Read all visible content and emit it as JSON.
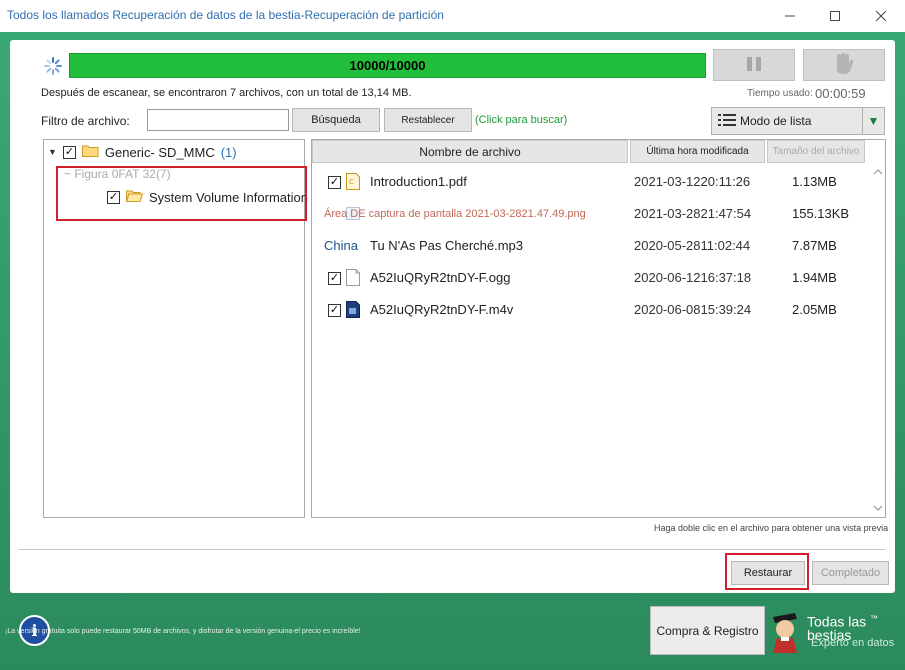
{
  "window": {
    "title": "Todos los llamados Recuperación de datos de la bestia-Recuperación de partición",
    "minimize_icon": "minimize-icon",
    "maximize_icon": "maximize-icon",
    "close_icon": "close-icon"
  },
  "scan": {
    "progress_text": "10000/10000",
    "progress_fraction": 1.0,
    "summary": "Después de escanear, se encontraron 7 archivos, con un total de 13,14 MB.",
    "time_label": "Tiempo usado:",
    "time_value": "00:00:59"
  },
  "filter": {
    "label": "Filtro de archivo:",
    "input_value": "",
    "search_label": "Búsqueda",
    "reset_label": "Restablecer",
    "hint": "(Click para buscar)"
  },
  "view": {
    "mode_label": "Modo de lista"
  },
  "tree": {
    "root_label": "Generic- SD_MMC",
    "root_count": "(1)",
    "partition_label": "~ Figura 0FAT 32(7)",
    "folder_label": "System Volume Information"
  },
  "table": {
    "headers": {
      "name": "Nombre de archivo",
      "modified": "Última hora modificada",
      "size": "Tamaño del archivo"
    },
    "rows": [
      {
        "name": "Introduction1.pdf",
        "date": "2021-03-1220:11:26",
        "size": "1.13MB",
        "checked": true,
        "icon": "pdf-file-icon"
      },
      {
        "name": "Área DE captura de pantalla 2021-03-2821.47.49.png",
        "date": "2021-03-2821:47:54",
        "size": "155.13KB",
        "checked": false,
        "icon": "image-file-icon"
      },
      {
        "name": "Tu N'As Pas Cherché.mp3",
        "prefix": "China",
        "date": "2020-05-2811:02:44",
        "size": "7.87MB",
        "checked": false,
        "icon": "audio-file-icon"
      },
      {
        "name": "A52IuQRyR2tnDY-F.ogg",
        "date": "2020-06-1216:37:18",
        "size": "1.94MB",
        "checked": true,
        "icon": "blank-file-icon"
      },
      {
        "name": "A52IuQRyR2tnDY-F.m4v",
        "date": "2020-06-0815:39:24",
        "size": "2.05MB",
        "checked": true,
        "icon": "video-file-icon"
      }
    ]
  },
  "preview_hint": "Haga doble clic en el archivo para obtener una vista previa",
  "actions": {
    "restore_label": "Restaurar",
    "complete_label": "Completado"
  },
  "footer": {
    "note": "¡La versión gratuita solo puede restaurar 50MB de archivos, y disfrutar de la versión genuina-el precio es increíble!",
    "buy_label": "Compra & Registro",
    "brand_line1": "Todas las",
    "brand_line1b": "bestias",
    "brand_tm": "™",
    "brand_line2": "Experto en datos"
  },
  "colors": {
    "accent_green": "#2b8a5d",
    "progress_green": "#22bf3c",
    "highlight_red": "#d0202a"
  }
}
